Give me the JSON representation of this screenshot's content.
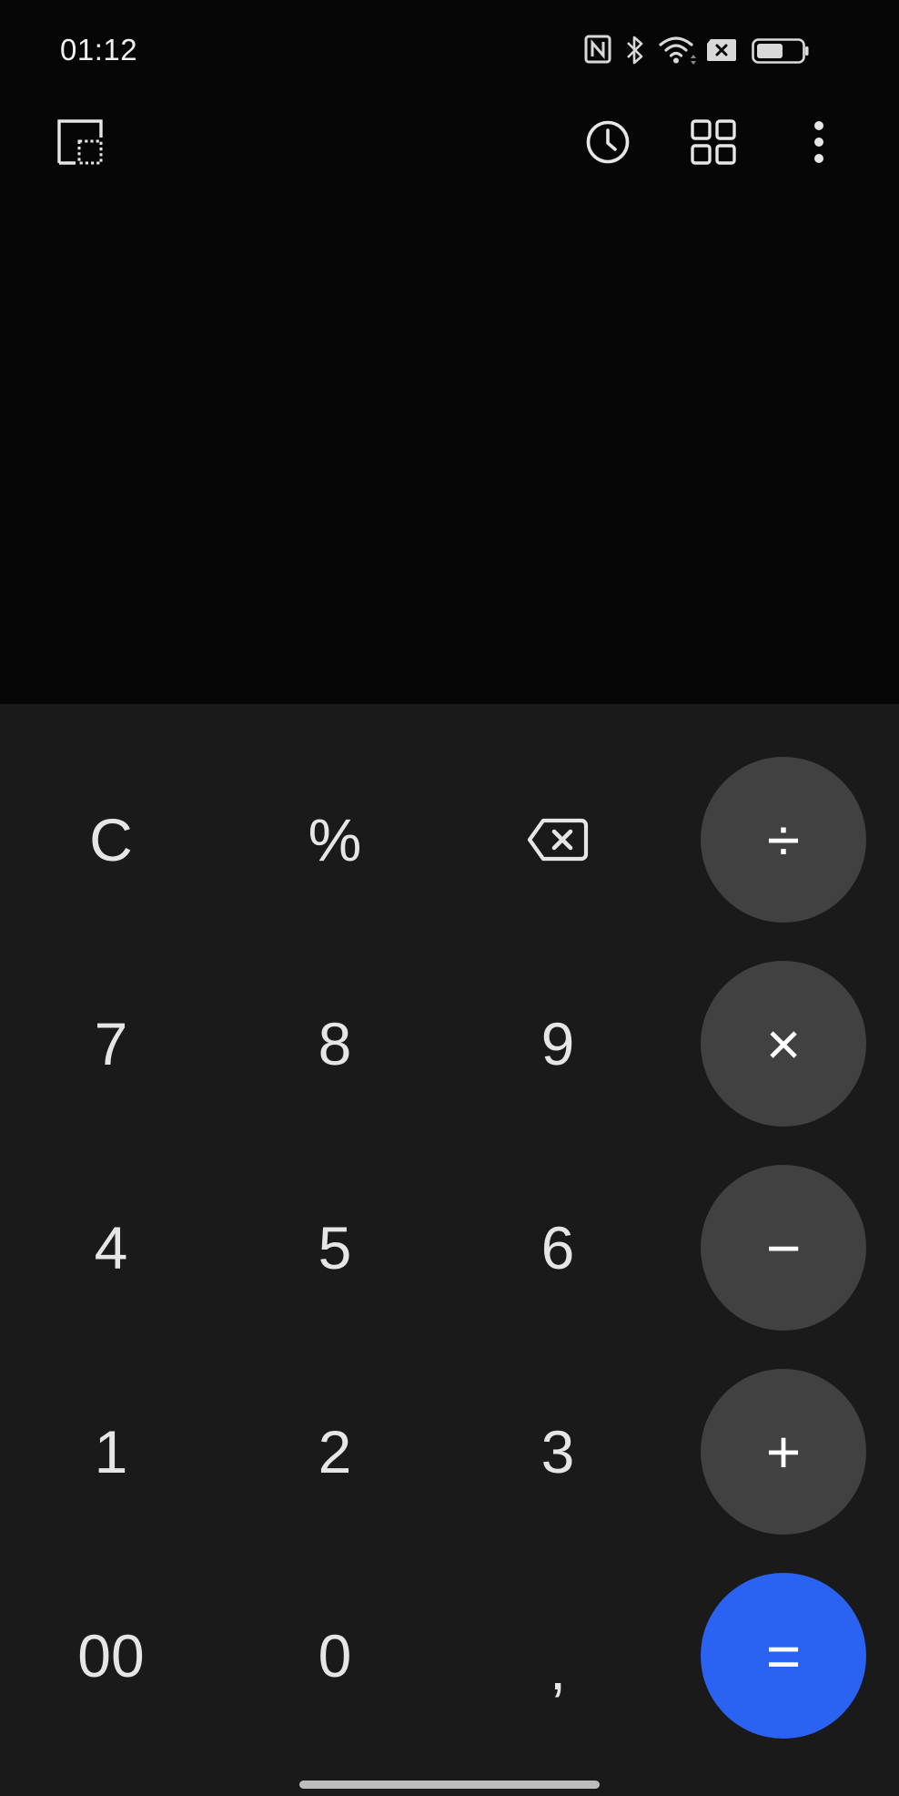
{
  "status_bar": {
    "time": "01:12",
    "icons": [
      "nfc-icon",
      "bluetooth-icon",
      "wifi-icon",
      "sim-blocked-icon",
      "battery-icon"
    ],
    "battery_level": 0.55
  },
  "toolbar": {
    "icons": [
      "window-mode-icon",
      "history-icon",
      "converter-grid-icon",
      "more-options-icon"
    ]
  },
  "display": {
    "expression": ""
  },
  "keypad": {
    "rows": [
      [
        "C",
        "%",
        "backspace",
        "÷"
      ],
      [
        "7",
        "8",
        "9",
        "×"
      ],
      [
        "4",
        "5",
        "6",
        "−"
      ],
      [
        "1",
        "2",
        "3",
        "+"
      ],
      [
        "00",
        "0",
        ",",
        "="
      ]
    ],
    "labels": {
      "clear": "C",
      "percent": "%",
      "divide": "÷",
      "multiply": "×",
      "minus": "−",
      "plus": "+",
      "equals": "=",
      "seven": "7",
      "eight": "8",
      "nine": "9",
      "four": "4",
      "five": "5",
      "six": "6",
      "one": "1",
      "two": "2",
      "three": "3",
      "double_zero": "00",
      "zero": "0",
      "decimal": ","
    }
  },
  "colors": {
    "background": "#060606",
    "keypad_background": "#1a1a1a",
    "operator_key": "#414141",
    "equals_key": "#2a62f1",
    "key_text": "#e6e6e6"
  }
}
